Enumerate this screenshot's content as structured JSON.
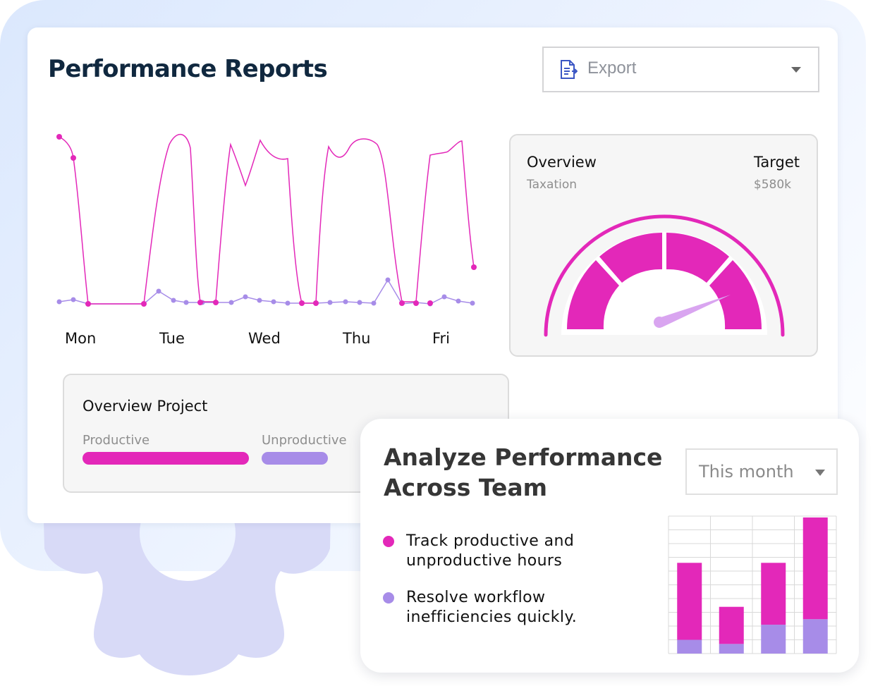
{
  "header": {
    "title": "Performance Reports"
  },
  "export": {
    "label": "Export",
    "icon": "document-export-icon"
  },
  "weekly_chart": {
    "days": [
      "Mon",
      "Tue",
      "Wed",
      "Thu",
      "Fri"
    ],
    "colors": {
      "productive": "#e328b9",
      "unproductive": "#a78ce8"
    }
  },
  "overview": {
    "title": "Overview",
    "subtitle": "Taxation",
    "target_title": "Target",
    "target_value": "$580k"
  },
  "project": {
    "title": "Overview Project",
    "productive_label": "Productive",
    "unproductive_label": "Unproductive",
    "colors": {
      "productive": "#e328b9",
      "unproductive": "#a78ce8"
    }
  },
  "analyze": {
    "title_line1": "Analyze Performance",
    "title_line2": "Across Team",
    "period": "This month",
    "bullets": [
      {
        "line1": "Track productive and",
        "line2": "unproductive hours",
        "color": "#e328b9"
      },
      {
        "line1": "Resolve workflow",
        "line2": "inefficiencies quickly.",
        "color": "#a78ce8"
      }
    ]
  },
  "chart_data": {
    "type": "bar",
    "stacked": true,
    "series": [
      {
        "values": [
          1,
          0.7,
          2.1,
          2.5
        ],
        "color": "#a78ce8"
      },
      {
        "values": [
          5.6,
          2.7,
          4.5,
          7.4
        ],
        "color": "#e328b9"
      }
    ],
    "ylim": [
      0,
      10
    ],
    "grid": true
  }
}
